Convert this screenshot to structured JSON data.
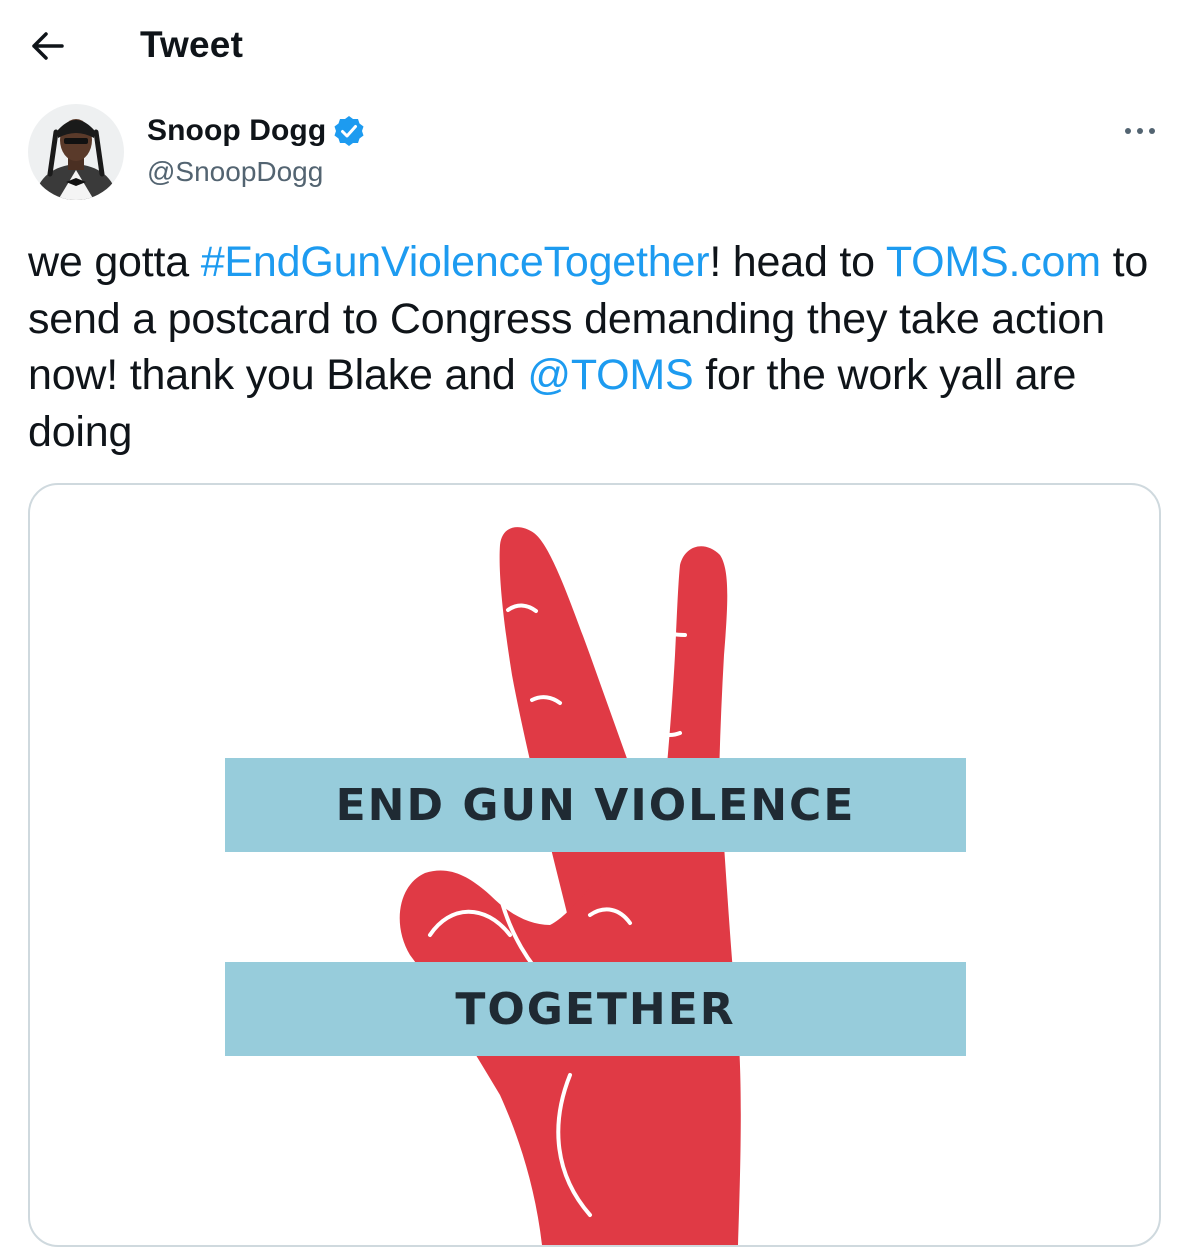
{
  "header": {
    "title": "Tweet"
  },
  "author": {
    "display_name": "Snoop Dogg",
    "handle": "@SnoopDogg",
    "verified": true
  },
  "tweet": {
    "text_1": "we gotta ",
    "hashtag": "#EndGunViolenceTogether",
    "text_2": "! head to ",
    "link": "TOMS.com",
    "text_3": " to send a postcard to Congress demanding they take action now! thank you Blake and ",
    "mention": "@TOMS",
    "text_4": " for the work yall are doing"
  },
  "media": {
    "line_1": "END GUN VIOLENCE",
    "line_2": "TOGETHER"
  },
  "icons": {
    "back": "arrow-left-icon",
    "verified": "verified-badge-icon",
    "more": "more-horizontal-icon"
  },
  "colors": {
    "link": "#1d9bf0",
    "hand": "#e03a45",
    "banner": "#97ccdb",
    "secondary_text": "#536471",
    "verified": "#1d9bf0"
  }
}
